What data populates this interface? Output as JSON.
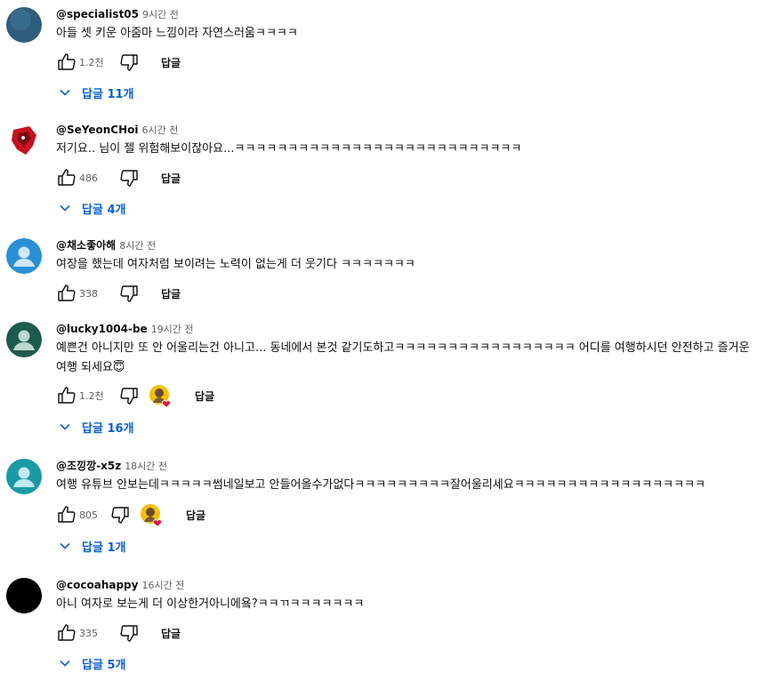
{
  "comments": [
    {
      "handle": "@specialist05",
      "time": "9시간 전",
      "text": "아들 셋 키운 아줌마 느낌이라 자연스러움ㅋㅋㅋㅋ",
      "likes": "1.2천",
      "reply_label": "답글",
      "replies_label": "답글 11개",
      "avatar_color": "#2f5d7c"
    },
    {
      "handle": "@SeYeonCHoi",
      "time": "6시간 전",
      "text": "저기요.. 님이 젤 위험해보이잖아요...ㅋㅋㅋㅋㅋㅋㅋㅋㅋㅋㅋㅋㅋㅋㅋㅋㅋㅋㅋㅋㅋㅋㅋㅋㅋㅋㅋ",
      "likes": "486",
      "reply_label": "답글",
      "replies_label": "답글 4개",
      "avatar_color": "#c8101e"
    },
    {
      "handle": "@채소좋아해",
      "time": "8시간 전",
      "text": "여장을 했는데 여자처럼 보이려는 노력이 없는게 더 웃기다 ㅋㅋㅋㅋㅋㅋㅋ",
      "likes": "338",
      "reply_label": "답글",
      "avatar_color": "#2b8fd6"
    },
    {
      "handle": "@lucky1004-be",
      "time": "19시간 전",
      "text": "예쁜건 아니지만 또 안 어울리는건 아니고... 동네에서 본것 같기도하고ㅋㅋㅋㅋㅋㅋㅋㅋㅋㅋㅋㅋㅋㅋㅋㅋㅋ 어디를 여행하시던 안전하고 즐거운여행 되세요😇",
      "likes": "1.2천",
      "reply_label": "답글",
      "replies_label": "답글 16개",
      "avatar_color": "#1d5b4a"
    },
    {
      "handle": "@조낑깡-x5z",
      "time": "18시간 전",
      "text": "여행 유튜브 안보는데ㅋㅋㅋㅋㅋ썸네일보고 안들어올수가없다ㅋㅋㅋㅋㅋㅋㅋㅋㅋ잘어울리세요ㅋㅋㅋㅋㅋㅋㅋㅋㅋㅋㅋㅋㅋㅋㅋㅋㅋㅋ",
      "likes": "805",
      "reply_label": "답글",
      "replies_label": "답글 1개",
      "avatar_color": "#1a9aa6"
    },
    {
      "handle": "@cocoahappy",
      "time": "16시간 전",
      "text": "아니 여자로 보는게 더 이상한거아니에욬?ㅋㅋㄲㅋㅋㅋㅋㅋㅋㅋ",
      "likes": "335",
      "reply_label": "답글",
      "replies_label": "답글 5개",
      "avatar_color": "#000000"
    }
  ],
  "colors": {
    "link_blue": "#065fd4",
    "secondary_text": "#606060",
    "heart_red": "#e0123a"
  },
  "icons": {
    "like": "thumbs-up-icon",
    "dislike": "thumbs-down-icon",
    "expand": "chevron-down-icon",
    "creator_heart": "creator-heart-icon"
  }
}
